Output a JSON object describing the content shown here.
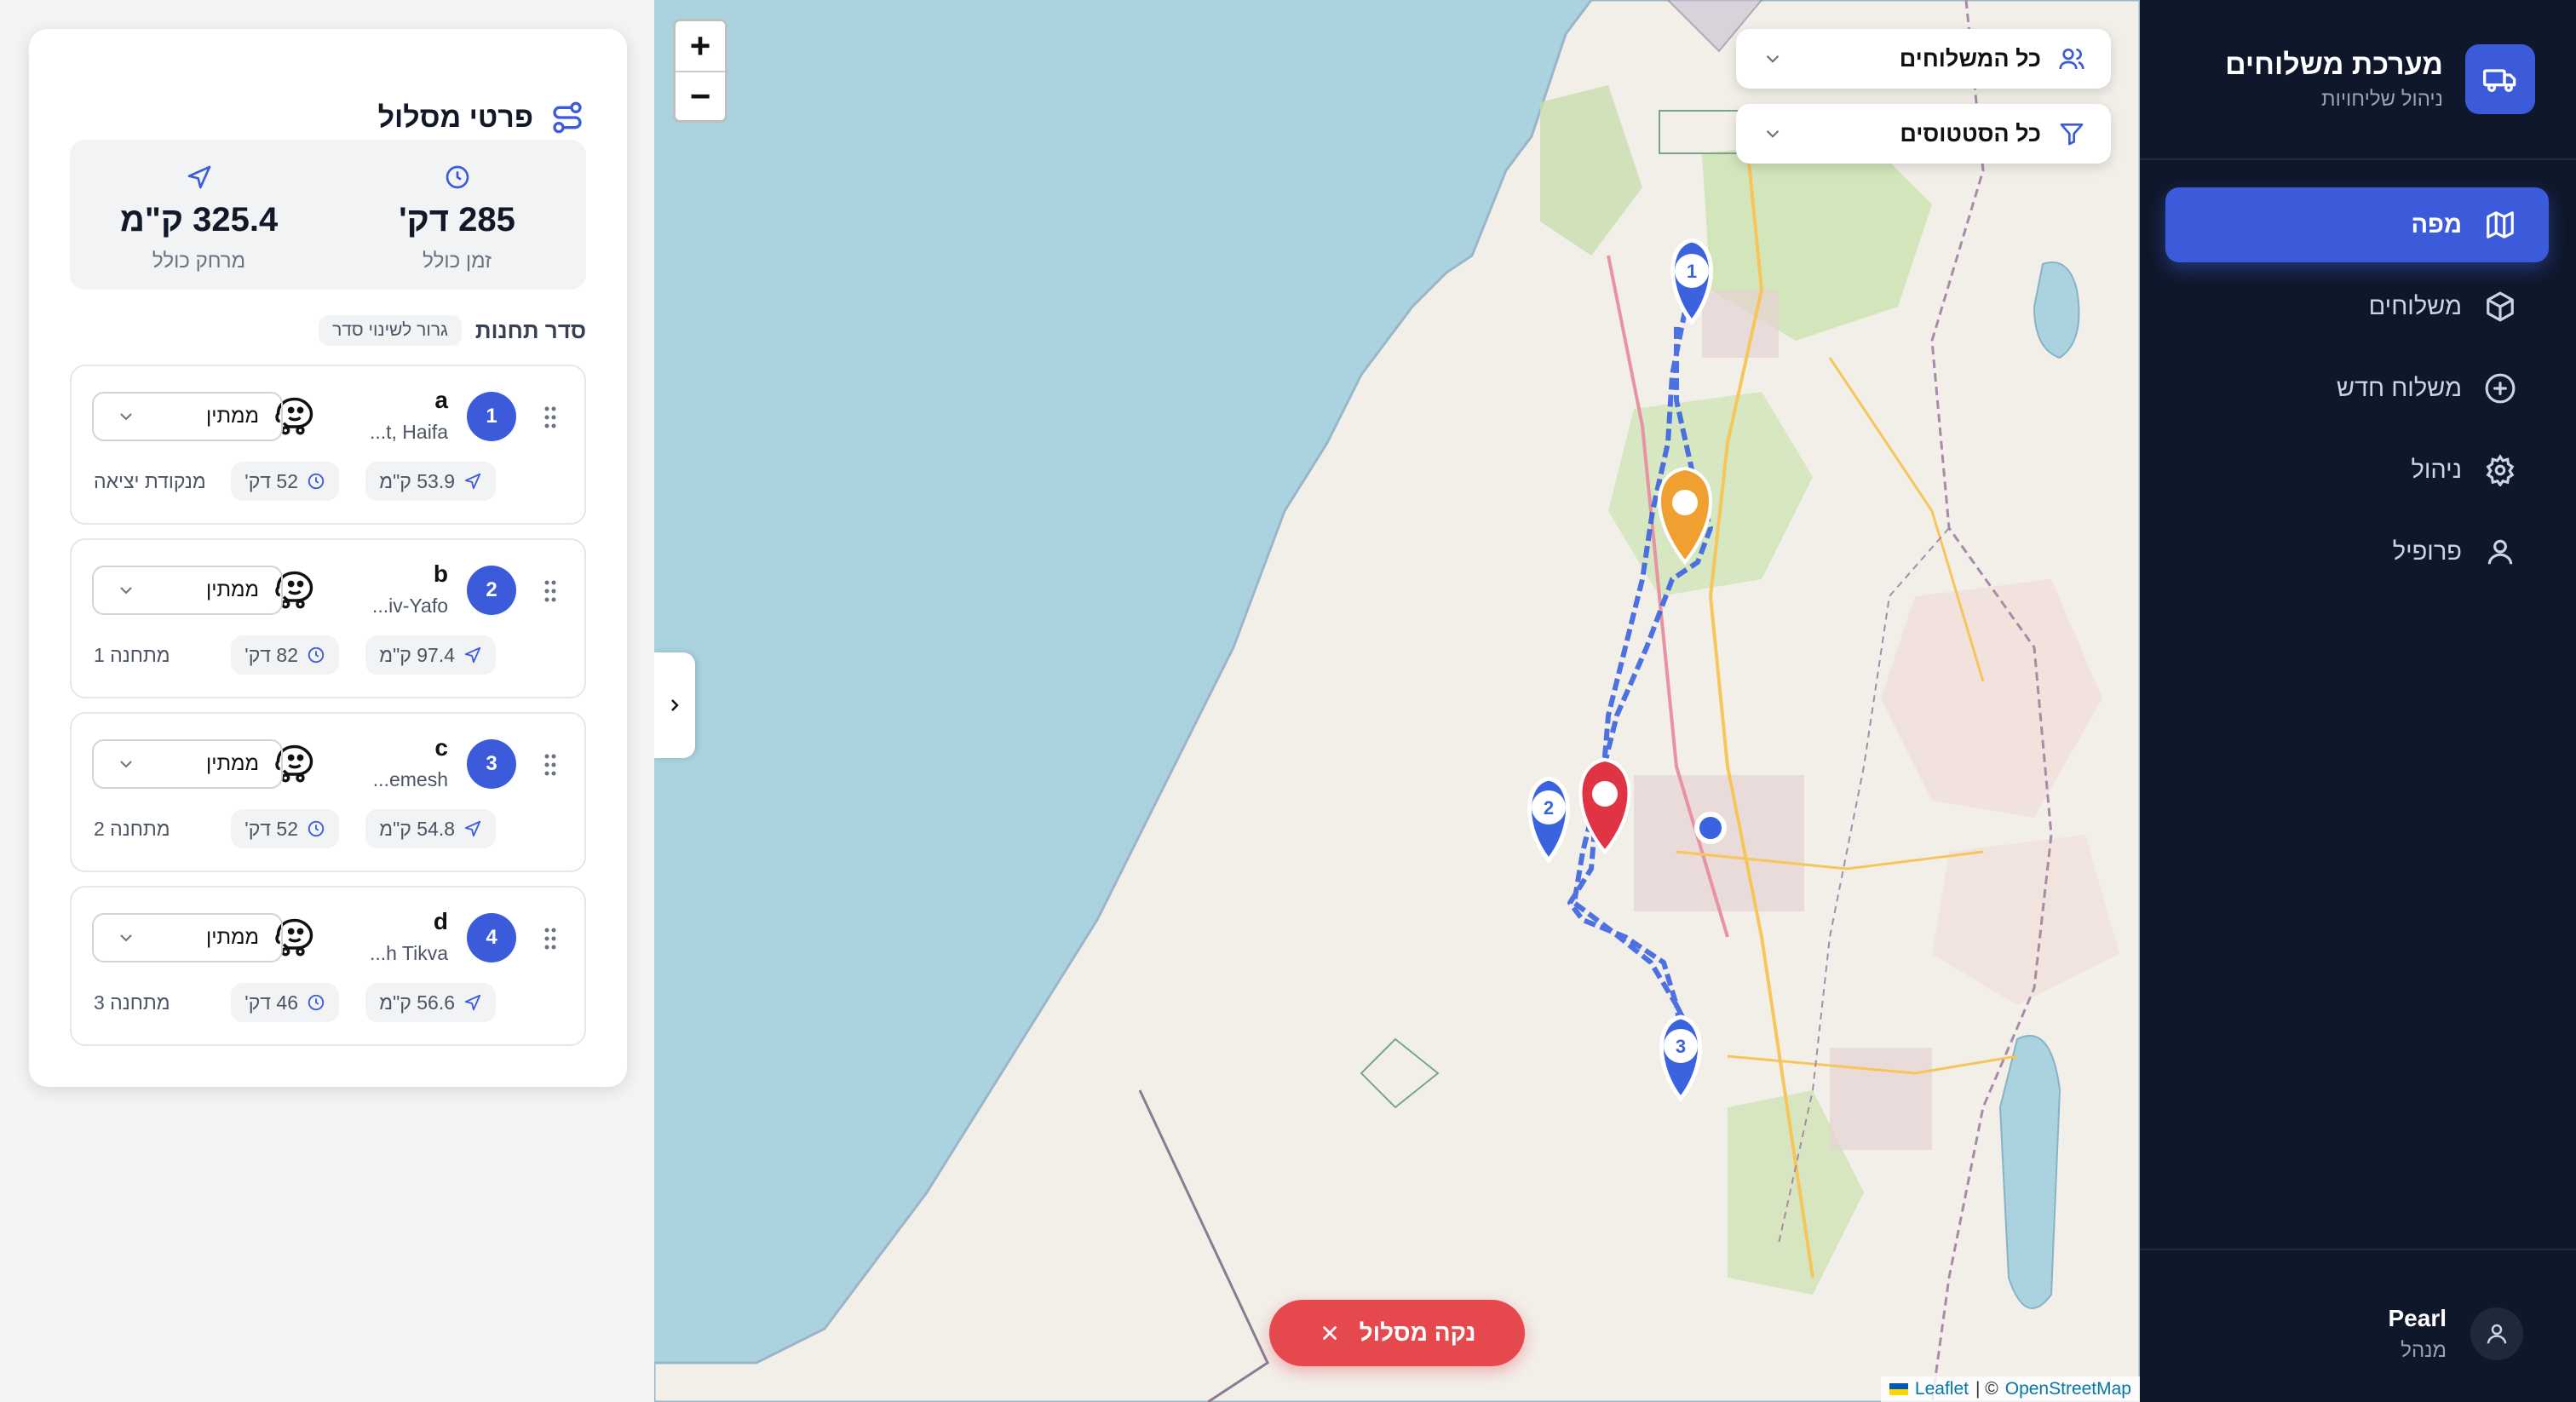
{
  "app": {
    "title": "מערכת משלוחים",
    "subtitle": "ניהול שליחויות"
  },
  "nav": {
    "items": [
      {
        "label": "מפה",
        "icon": "map-icon",
        "active": true
      },
      {
        "label": "משלוחים",
        "icon": "package-icon",
        "active": false
      },
      {
        "label": "משלוח חדש",
        "icon": "plus-circle-icon",
        "active": false
      },
      {
        "label": "ניהול",
        "icon": "gear-icon",
        "active": false
      },
      {
        "label": "פרופיל",
        "icon": "user-icon",
        "active": false
      }
    ]
  },
  "user": {
    "name": "Pearl",
    "role": "מנהל"
  },
  "map": {
    "zoom_in": "+",
    "zoom_out": "−",
    "filter_couriers": "כל המשלוחים",
    "filter_status": "כל הסטטוסים",
    "clear_route": "נקה מסלול",
    "attribution_leaflet": "Leaflet",
    "attribution_sep": "| ©",
    "attribution_osm": "OpenStreetMap",
    "marker_labels": [
      "1",
      "2",
      "3"
    ]
  },
  "route": {
    "title": "פרטי מסלול",
    "total_distance": "325.4 ק\"מ",
    "total_distance_label": "מרחק כולל",
    "total_time": "285 דק'",
    "total_time_label": "זמן כולל",
    "order_title": "סדר תחנות",
    "drag_hint": "גרור לשינוי סדר",
    "stops": [
      {
        "num": "1",
        "name": "a",
        "address": "...t, Haifa",
        "status": "ממתין",
        "distance": "53.9 ק\"מ",
        "time": "52 דק'",
        "note": "מנקודת יציאה"
      },
      {
        "num": "2",
        "name": "b",
        "address": "...iv-Yafo",
        "status": "ממתין",
        "distance": "97.4 ק\"מ",
        "time": "82 דק'",
        "note": "מתחנה 1"
      },
      {
        "num": "3",
        "name": "c",
        "address": "...emesh",
        "status": "ממתין",
        "distance": "54.8 ק\"מ",
        "time": "52 דק'",
        "note": "מתחנה 2"
      },
      {
        "num": "4",
        "name": "d",
        "address": "...h Tikva",
        "status": "ממתין",
        "distance": "56.6 ק\"מ",
        "time": "46 דק'",
        "note": "מתחנה 3"
      }
    ]
  },
  "colors": {
    "sidebar_bg": "#0f172a",
    "accent": "#3b5bdb",
    "danger": "#e5484d",
    "warning_marker": "#f0a030",
    "sea": "#aad3df",
    "land": "#f2efe9"
  }
}
